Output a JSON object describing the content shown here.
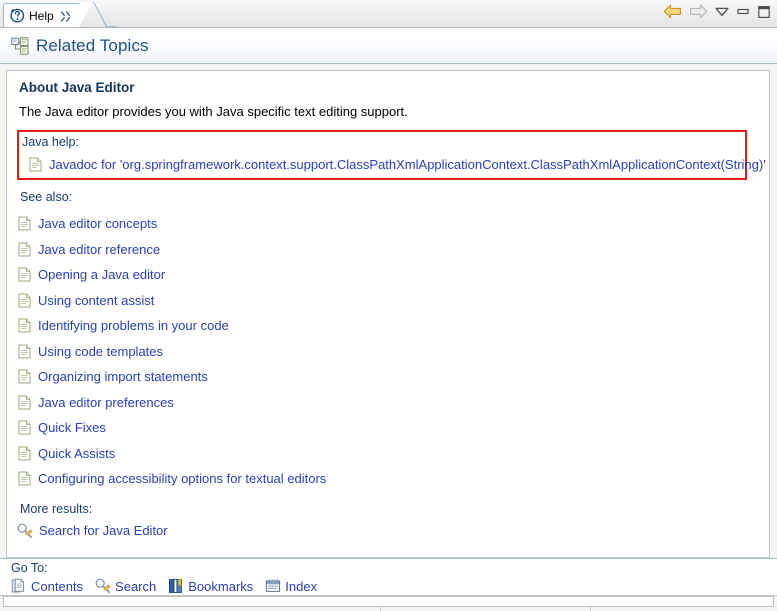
{
  "window": {
    "tab": {
      "label": "Help",
      "icon": "help-question-icon",
      "close_icon": "close-x-icon"
    },
    "tools": [
      {
        "name": "back-arrow-icon",
        "label": "Back"
      },
      {
        "name": "forward-arrow-icon",
        "label": "Forward"
      },
      {
        "name": "view-menu-chevron-icon",
        "label": "View Menu"
      },
      {
        "name": "minimize-icon",
        "label": "Minimize"
      },
      {
        "name": "maximize-icon",
        "label": "Maximize"
      }
    ]
  },
  "header": {
    "title": "Related Topics",
    "icon": "related-topics-icon"
  },
  "main": {
    "section_title": "About Java Editor",
    "intro": "The Java editor provides you with Java specific text editing support.",
    "highlight": {
      "color": "#e01b18",
      "group_label": "Java help:",
      "links": [
        {
          "icon": "document-icon",
          "label": "Javadoc for 'org.springframework.context.support.ClassPathXmlApplicationContext.ClassPathXmlApplicationContext(String)'"
        }
      ]
    },
    "see_also_label": "See also:",
    "see_also": [
      {
        "icon": "document-icon",
        "label": "Java editor concepts"
      },
      {
        "icon": "document-icon",
        "label": "Java editor reference"
      },
      {
        "icon": "document-icon",
        "label": "Opening a Java editor"
      },
      {
        "icon": "document-icon",
        "label": "Using content assist"
      },
      {
        "icon": "document-icon",
        "label": "Identifying problems in your code"
      },
      {
        "icon": "document-icon",
        "label": "Using code templates"
      },
      {
        "icon": "document-icon",
        "label": "Organizing import statements"
      },
      {
        "icon": "document-icon",
        "label": "Java editor preferences"
      },
      {
        "icon": "document-icon",
        "label": "Quick Fixes"
      },
      {
        "icon": "document-icon",
        "label": "Quick Assists"
      },
      {
        "icon": "document-icon",
        "label": "Configuring accessibility options for textual editors"
      }
    ],
    "more_results_label": "More results:",
    "more_results": [
      {
        "icon": "search-key-icon",
        "label": "Search for Java Editor"
      }
    ]
  },
  "goto": {
    "label": "Go To:",
    "items": [
      {
        "icon": "contents-icon",
        "label": "Contents"
      },
      {
        "icon": "search-key-icon",
        "label": "Search"
      },
      {
        "icon": "bookmarks-icon",
        "label": "Bookmarks"
      },
      {
        "icon": "index-icon",
        "label": "Index"
      }
    ]
  },
  "colors": {
    "link": "#2a3fb0",
    "heading": "#10365e",
    "title": "#1f4f82",
    "highlight_box": "#e01b18"
  }
}
